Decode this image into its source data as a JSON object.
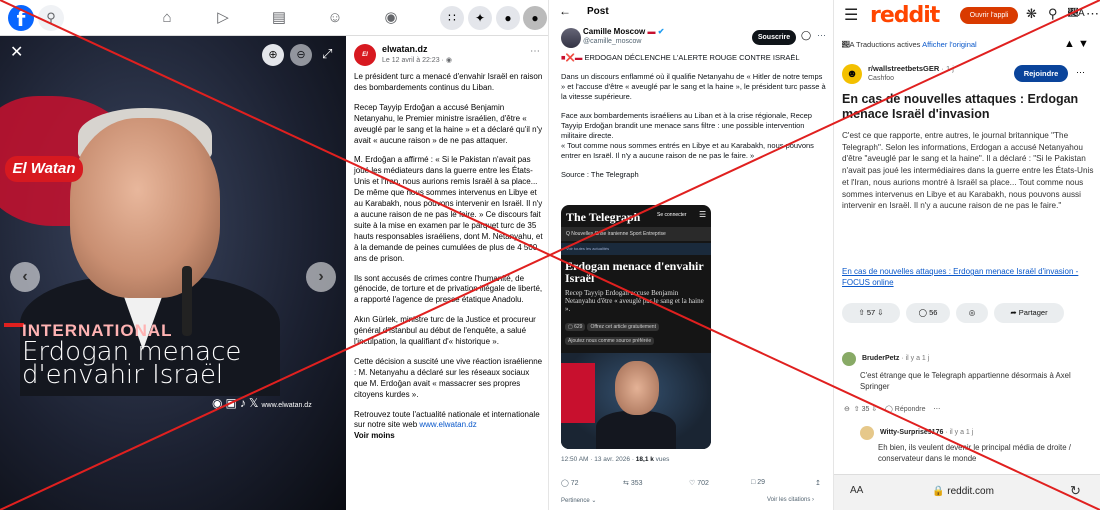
{
  "colors": {
    "cross": "#e0201f",
    "facebook_blue": "#0866ff",
    "reddit_orange": "#ff4500",
    "reddit_join": "#0a449b",
    "elwatan_red": "#d71920"
  },
  "facebook": {
    "photo": {
      "brand": "El Watan",
      "category": "INTERNATIONAL",
      "title": "Erdogan menace d'envahir Israël",
      "site": "www.elwatan.dz"
    },
    "post": {
      "page_name": "elwatan.dz",
      "avatar_label": "El Watan",
      "time": "Le 12 avril à 22:23 · ",
      "paragraphs": [
        "Le président turc a menacé d'envahir Israël en raison des bombardements continus du Liban.",
        "Recep Tayyip Erdoğan a accusé Benjamin Netanyahu, le Premier ministre israélien, d'être « aveuglé par le sang et la haine » et a déclaré qu'il n'y avait « aucune raison » de ne pas attaquer.",
        "M. Erdoğan a affirmé : « Si le Pakistan n'avait pas joué les médiateurs dans la guerre entre les États-Unis et l'Iran, nous aurions remis Israël à sa place... De même que nous sommes intervenus en Libye et au Karabakh, nous pouvons intervenir en Israël. Il n'y a aucune raison de ne pas le faire. » Ce discours fait suite à la mise en examen par le parquet turc de 35 hauts responsables israéliens, dont M. Netanyahu, et à la demande de peines cumulées de plus de 4 500 ans de prison.",
        "Ils sont accusés de crimes contre l'humanité, de génocide, de torture et de privation illégale de liberté, a rapporté l'agence de presse étatique Anadolu.",
        "Akın Gürlek, ministre turc de la Justice et procureur général d'Istanbul au début de l'enquête, a salué l'inculpation, la qualifiant d'« historique ».",
        "Cette décision a suscité une vive réaction israélienne : M. Netanyahu a déclaré sur les réseaux sociaux que M. Erdoğan avait « massacrer ses propres citoyens kurdes »."
      ],
      "footer_text": "Retrouvez toute l'actualité nationale et internationale sur notre site web ",
      "footer_link": "www.elwatan.dz",
      "see_more": "Voir moins"
    },
    "nav_icons": [
      "home-icon",
      "video-icon",
      "marketplace-icon",
      "groups-icon",
      "gaming-icon"
    ],
    "right_icons": [
      "menu-grid-icon",
      "messenger-icon",
      "notifications-icon",
      "profile-icon"
    ]
  },
  "twitter": {
    "header": "Post",
    "author": "Camille Moscow",
    "handle": "@camille_moscow",
    "subscribe": "Souscrire",
    "headline": "ERDOGAN DÉCLENCHE L'ALERTE ROUGE CONTRE ISRAËL",
    "paragraphs": [
      "Dans un discours enflammé où il qualifie Netanyahu de « Hitler de notre temps » et l'accuse d'être « aveuglé par le sang et la haine », le président turc passe à la vitesse supérieure.",
      "Face aux bombardements israéliens au Liban et à la crise régionale, Recep Tayyip Erdoğan brandit une menace sans filtre : une possible intervention militaire directe.",
      "« Tout comme nous sommes entrés en Libye et au Karabakh, nous pouvons entrer en Israël. Il n'y a aucune raison de ne pas le faire. »",
      "Source : The Telegraph"
    ],
    "card": {
      "logo": "The Telegraph",
      "connect": "Se connecter",
      "nav": "Q   Nouvelles   Crise iranienne   Sport   Entreprise",
      "band": "Voir toutes les actualités",
      "headline": "Erdogan menace d'envahir Israël",
      "sub": "Recep Tayyip Erdogan accuse Benjamin Netanyahu d'être « aveuglé par le sang et la haine ».",
      "comments": "629",
      "gift": "Offrez cet article gratuitement",
      "pref": "Ajoutez nous comme source préférée"
    },
    "time": "12:50 AM · 13 avr. 2026 · ",
    "views_count": "18,1 k",
    "views_label": " vues",
    "stats": {
      "replies": "72",
      "retweets": "353",
      "likes": "702",
      "bookmarks": "29"
    },
    "sort": "Pertinence",
    "quotes": "Voir les citations"
  },
  "reddit": {
    "open_app": "Ouvrir l'appli",
    "translation_label": "Traductions actives ",
    "translation_link": "Afficher l'original",
    "subreddit": "r/wallstreetbetsGER",
    "sub_time": " · 1 j",
    "user": "Cashfoo",
    "join": "Rejoindre",
    "title": "En cas de nouvelles attaques : Erdogan menace Israël d'invasion",
    "body": "C'est ce que rapporte, entre autres, le journal britannique \"The Telegraph\". Selon les informations, Erdogan a accusé Netanyahou d'être \"aveuglé par le sang et la haine\". Il a déclaré : \"Si le Pakistan n'avait pas joué les intermédiaires dans la guerre entre les États-Unis et l'Iran, nous aurions montré à Israël sa place... Tout comme nous sommes intervenus en Libye et au Karabakh, nous pouvons aussi intervenir en Israël. Il n'y a aucune raison de ne pas le faire.\"",
    "link": "En cas de nouvelles attaques : Erdogan menace Israël d'invasion - FOCUS online",
    "votes": "57",
    "comments_count": "56",
    "share": "Partager",
    "comments": [
      {
        "author": "BruderPetz",
        "time": " · il y a 1 j",
        "text": "C'est étrange que le Telegraph appartienne désormais à Axel Springer",
        "votes": "35",
        "reply": "Répondre"
      },
      {
        "author": "Witty-Surprise9176",
        "time": " · il y a 1 j",
        "text": "Eh bien, ils veulent devenir le principal média de droite / conservateur dans le monde"
      }
    ],
    "aa": "AA",
    "url": "reddit.com"
  }
}
